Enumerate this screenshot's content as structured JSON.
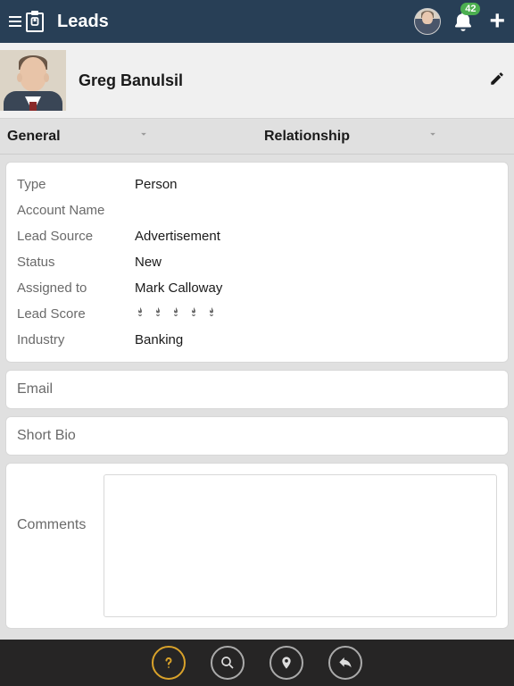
{
  "header": {
    "title": "Leads",
    "notification_count": "42"
  },
  "lead": {
    "name": "Greg Banulsil"
  },
  "tabs": {
    "general": "General",
    "relationship": "Relationship"
  },
  "general_card": {
    "fields": {
      "type_label": "Type",
      "type_value": "Person",
      "account_name_label": "Account Name",
      "account_name_value": "",
      "lead_source_label": "Lead Source",
      "lead_source_value": "Advertisement",
      "status_label": "Status",
      "status_value": "New",
      "assigned_to_label": "Assigned to",
      "assigned_to_value": "Mark Calloway",
      "lead_score_label": "Lead Score",
      "lead_score_value": 5,
      "industry_label": "Industry",
      "industry_value": "Banking"
    }
  },
  "sections": {
    "email": "Email",
    "short_bio": "Short Bio",
    "comments": "Comments"
  }
}
